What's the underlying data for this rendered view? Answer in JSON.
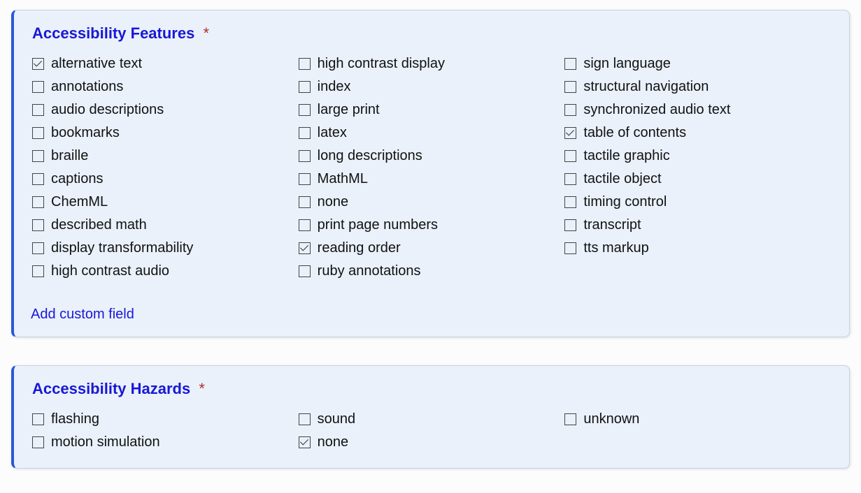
{
  "features": {
    "title": "Accessibility Features",
    "required_mark": "*",
    "add_custom_label": "Add custom field",
    "columns": [
      [
        {
          "id": "alternative-text",
          "label": "alternative text",
          "checked": true
        },
        {
          "id": "annotations",
          "label": "annotations",
          "checked": false
        },
        {
          "id": "audio-descriptions",
          "label": "audio descriptions",
          "checked": false
        },
        {
          "id": "bookmarks",
          "label": "bookmarks",
          "checked": false
        },
        {
          "id": "braille",
          "label": "braille",
          "checked": false
        },
        {
          "id": "captions",
          "label": "captions",
          "checked": false
        },
        {
          "id": "chemml",
          "label": "ChemML",
          "checked": false
        },
        {
          "id": "described-math",
          "label": "described math",
          "checked": false
        },
        {
          "id": "display-transformability",
          "label": "display transformability",
          "checked": false
        },
        {
          "id": "high-contrast-audio",
          "label": "high contrast audio",
          "checked": false
        }
      ],
      [
        {
          "id": "high-contrast-display",
          "label": "high contrast display",
          "checked": false
        },
        {
          "id": "index",
          "label": "index",
          "checked": false
        },
        {
          "id": "large-print",
          "label": "large print",
          "checked": false
        },
        {
          "id": "latex",
          "label": "latex",
          "checked": false
        },
        {
          "id": "long-descriptions",
          "label": "long descriptions",
          "checked": false
        },
        {
          "id": "mathml",
          "label": "MathML",
          "checked": false
        },
        {
          "id": "none-feat",
          "label": "none",
          "checked": false
        },
        {
          "id": "print-page-numbers",
          "label": "print page numbers",
          "checked": false
        },
        {
          "id": "reading-order",
          "label": "reading order",
          "checked": true
        },
        {
          "id": "ruby-annotations",
          "label": "ruby annotations",
          "checked": false
        }
      ],
      [
        {
          "id": "sign-language",
          "label": "sign language",
          "checked": false
        },
        {
          "id": "structural-navigation",
          "label": "structural navigation",
          "checked": false
        },
        {
          "id": "synchronized-audio-text",
          "label": "synchronized audio text",
          "checked": false
        },
        {
          "id": "table-of-contents",
          "label": "table of contents",
          "checked": true
        },
        {
          "id": "tactile-graphic",
          "label": "tactile graphic",
          "checked": false
        },
        {
          "id": "tactile-object",
          "label": "tactile object",
          "checked": false
        },
        {
          "id": "timing-control",
          "label": "timing control",
          "checked": false
        },
        {
          "id": "transcript",
          "label": "transcript",
          "checked": false
        },
        {
          "id": "tts-markup",
          "label": "tts markup",
          "checked": false
        }
      ]
    ]
  },
  "hazards": {
    "title": "Accessibility Hazards",
    "required_mark": "*",
    "columns": [
      [
        {
          "id": "flashing",
          "label": "flashing",
          "checked": false
        },
        {
          "id": "motion-simulation",
          "label": "motion simulation",
          "checked": false
        }
      ],
      [
        {
          "id": "sound",
          "label": "sound",
          "checked": false
        },
        {
          "id": "none-haz",
          "label": "none",
          "checked": true
        }
      ],
      [
        {
          "id": "unknown",
          "label": "unknown",
          "checked": false
        }
      ]
    ]
  }
}
